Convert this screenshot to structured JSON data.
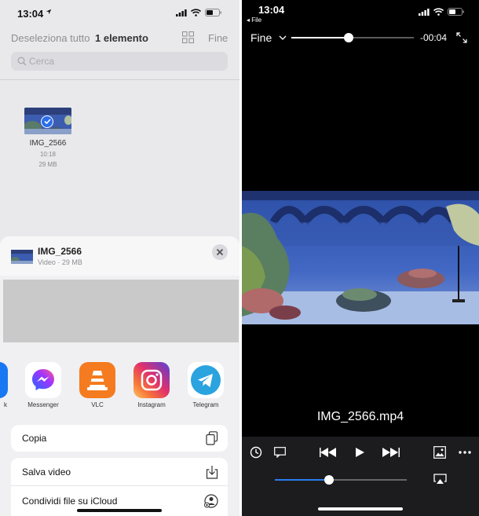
{
  "left": {
    "status": {
      "time": "13:04"
    },
    "toolbar": {
      "deselect_all": "Deseleziona tutto",
      "selection_count": "1 elemento",
      "done": "Fine"
    },
    "search": {
      "placeholder": "Cerca"
    },
    "file": {
      "name": "IMG_2566",
      "time": "10:18",
      "size": "29 MB"
    },
    "share_sheet": {
      "title": "IMG_2566",
      "subtitle": "Video · 29 MB",
      "apps": [
        {
          "label": "k",
          "icon": "facebook-icon"
        },
        {
          "label": "Messenger",
          "icon": "messenger-icon"
        },
        {
          "label": "VLC",
          "icon": "vlc-icon"
        },
        {
          "label": "Instagram",
          "icon": "instagram-icon"
        },
        {
          "label": "Telegram",
          "icon": "telegram-icon"
        }
      ],
      "actions": [
        {
          "label": "Copia",
          "icon": "copy-icon"
        },
        {
          "label": "Salva video",
          "icon": "download-icon"
        },
        {
          "label": "Condividi file su iCloud",
          "icon": "icloud-share-icon"
        }
      ]
    }
  },
  "right": {
    "status": {
      "time": "13:04",
      "back_label": "◂ File"
    },
    "player": {
      "done": "Fine",
      "remaining": "-00:04",
      "progress": 0.47,
      "volume": 0.41,
      "filename": "IMG_2566.mp4"
    }
  },
  "colors": {
    "accent_blue": "#2b6ee8",
    "volume_blue": "#2a7cf0",
    "player_bg": "#000000",
    "controls_bg": "#1c1c1e"
  }
}
